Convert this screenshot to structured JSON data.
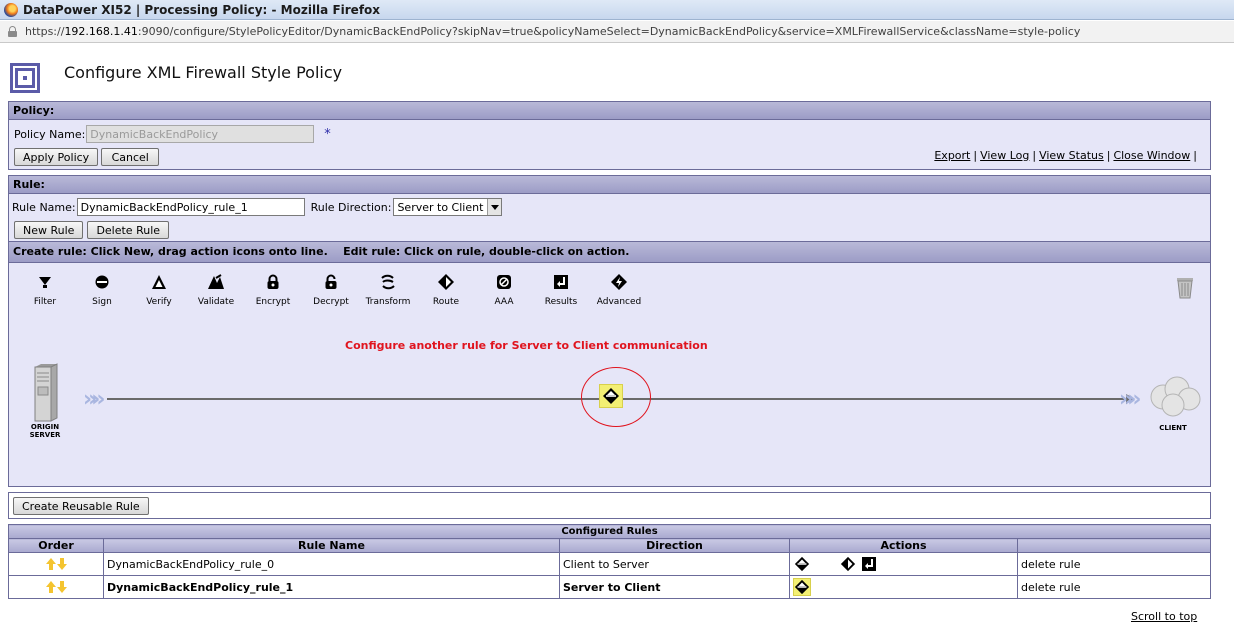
{
  "window": {
    "title": "DataPower XI52 | Processing Policy: - Mozilla Firefox",
    "url_prefix": "https://",
    "url_host": "192.168.1.41",
    "url_rest": ":9090/configure/StylePolicyEditor/DynamicBackEndPolicy?skipNav=true&policyNameSelect=DynamicBackEndPolicy&service=XMLFirewallService&className=style-policy"
  },
  "page": {
    "title": "Configure XML Firewall Style Policy"
  },
  "policy": {
    "header": "Policy:",
    "name_label": "Policy Name:",
    "name_value": "DynamicBackEndPolicy",
    "required_mark": "*",
    "apply_label": "Apply Policy",
    "cancel_label": "Cancel",
    "links": [
      "Export",
      "View Log",
      "View Status",
      "Close Window"
    ]
  },
  "rule": {
    "header": "Rule:",
    "name_label": "Rule Name:",
    "name_value": "DynamicBackEndPolicy_rule_1",
    "direction_label": "Rule Direction:",
    "direction_value": "Server to Client",
    "new_label": "New Rule",
    "delete_label": "Delete Rule",
    "instructions": "Create rule: Click New, drag action icons onto line.    Edit rule: Click on rule, double-click on action."
  },
  "palette": {
    "items": [
      {
        "label": "Filter",
        "icon": "filter-icon"
      },
      {
        "label": "Sign",
        "icon": "sign-icon"
      },
      {
        "label": "Verify",
        "icon": "verify-icon"
      },
      {
        "label": "Validate",
        "icon": "validate-icon"
      },
      {
        "label": "Encrypt",
        "icon": "encrypt-icon"
      },
      {
        "label": "Decrypt",
        "icon": "decrypt-icon"
      },
      {
        "label": "Transform",
        "icon": "transform-icon"
      },
      {
        "label": "Route",
        "icon": "route-icon"
      },
      {
        "label": "AAA",
        "icon": "aaa-icon"
      },
      {
        "label": "Results",
        "icon": "results-icon"
      },
      {
        "label": "Advanced",
        "icon": "advanced-icon"
      }
    ]
  },
  "canvas": {
    "annotation": "Configure another rule for Server to Client communication",
    "server_label_1": "ORIGIN",
    "server_label_2": "SERVER",
    "client_label": "CLIENT"
  },
  "reusable": {
    "label": "Create Reusable Rule"
  },
  "configured": {
    "caption": "Configured Rules",
    "headers": [
      "Order",
      "Rule Name",
      "Direction",
      "Actions",
      ""
    ],
    "rows": [
      {
        "name": "DynamicBackEndPolicy_rule_0",
        "direction": "Client to Server",
        "delete": "delete rule",
        "bold": false
      },
      {
        "name": "DynamicBackEndPolicy_rule_1",
        "direction": "Server to Client",
        "delete": "delete rule",
        "bold": true
      }
    ]
  },
  "footer": {
    "scroll_top": "Scroll to top"
  },
  "colors": {
    "panel": "#e6e6f8",
    "header": "#a9a9cf",
    "annotation": "#e0141e",
    "highlight": "#f3ef74"
  }
}
